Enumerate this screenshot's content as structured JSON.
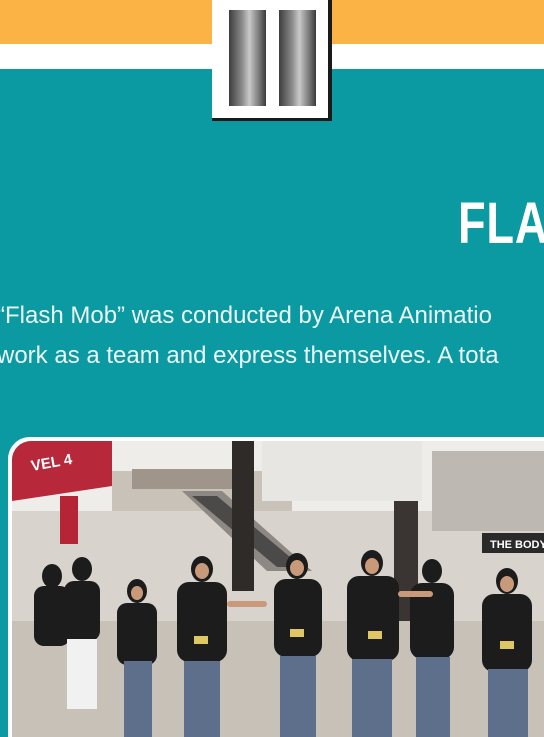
{
  "header": {
    "page_badge_icon": "roman-numeral-two-icon",
    "colors": {
      "top_band": "#fbb346",
      "page_background": "#0b99a2",
      "white_band": "#ffffff"
    }
  },
  "section": {
    "title": "FLA",
    "body_lines": [
      "“Flash Mob” was conducted by Arena Animatio",
      "work as a team and express themselves. A tota"
    ]
  },
  "photo": {
    "signs": {
      "level_sign": "VEL 4",
      "store_sign": "THE BODY S"
    }
  }
}
